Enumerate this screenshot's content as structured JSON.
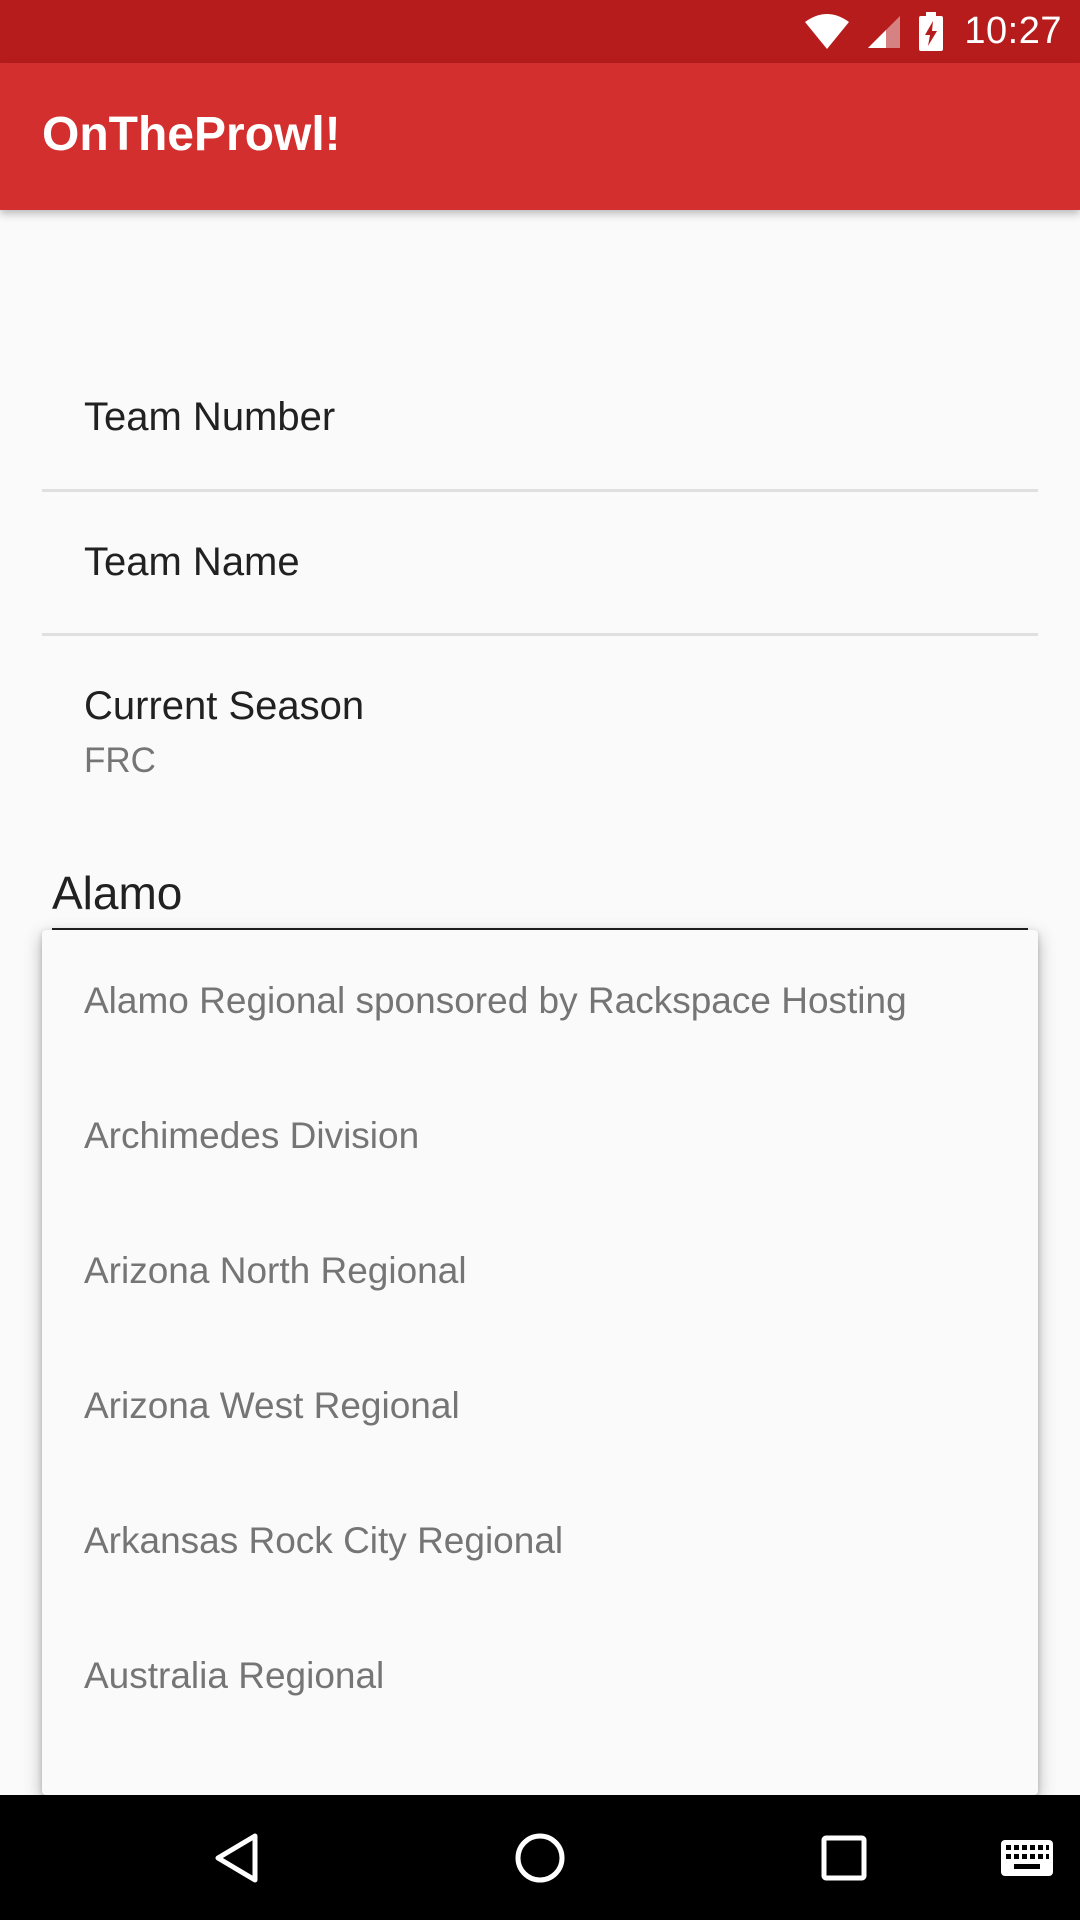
{
  "status_bar": {
    "time": "10:27",
    "icons": [
      "wifi-icon",
      "cell-signal-icon",
      "battery-charging-icon"
    ]
  },
  "app_bar": {
    "title": "OnTheProwl!",
    "color": "#d32f2f",
    "status_color": "#b71c1c"
  },
  "preferences": [
    {
      "title": "Team Number",
      "summary": ""
    },
    {
      "title": "Team Name",
      "summary": ""
    },
    {
      "title": "Current Season",
      "summary": "FRC"
    }
  ],
  "event_input": {
    "value": "Alamo"
  },
  "suggestions": [
    "Alamo Regional sponsored by Rackspace Hosting",
    "Archimedes Division",
    "Arizona North Regional",
    "Arizona West Regional",
    "Arkansas Rock City Regional",
    "Australia Regional"
  ],
  "nav_bar": {
    "buttons": [
      "back-icon",
      "home-icon",
      "recents-icon",
      "keyboard-icon"
    ]
  }
}
